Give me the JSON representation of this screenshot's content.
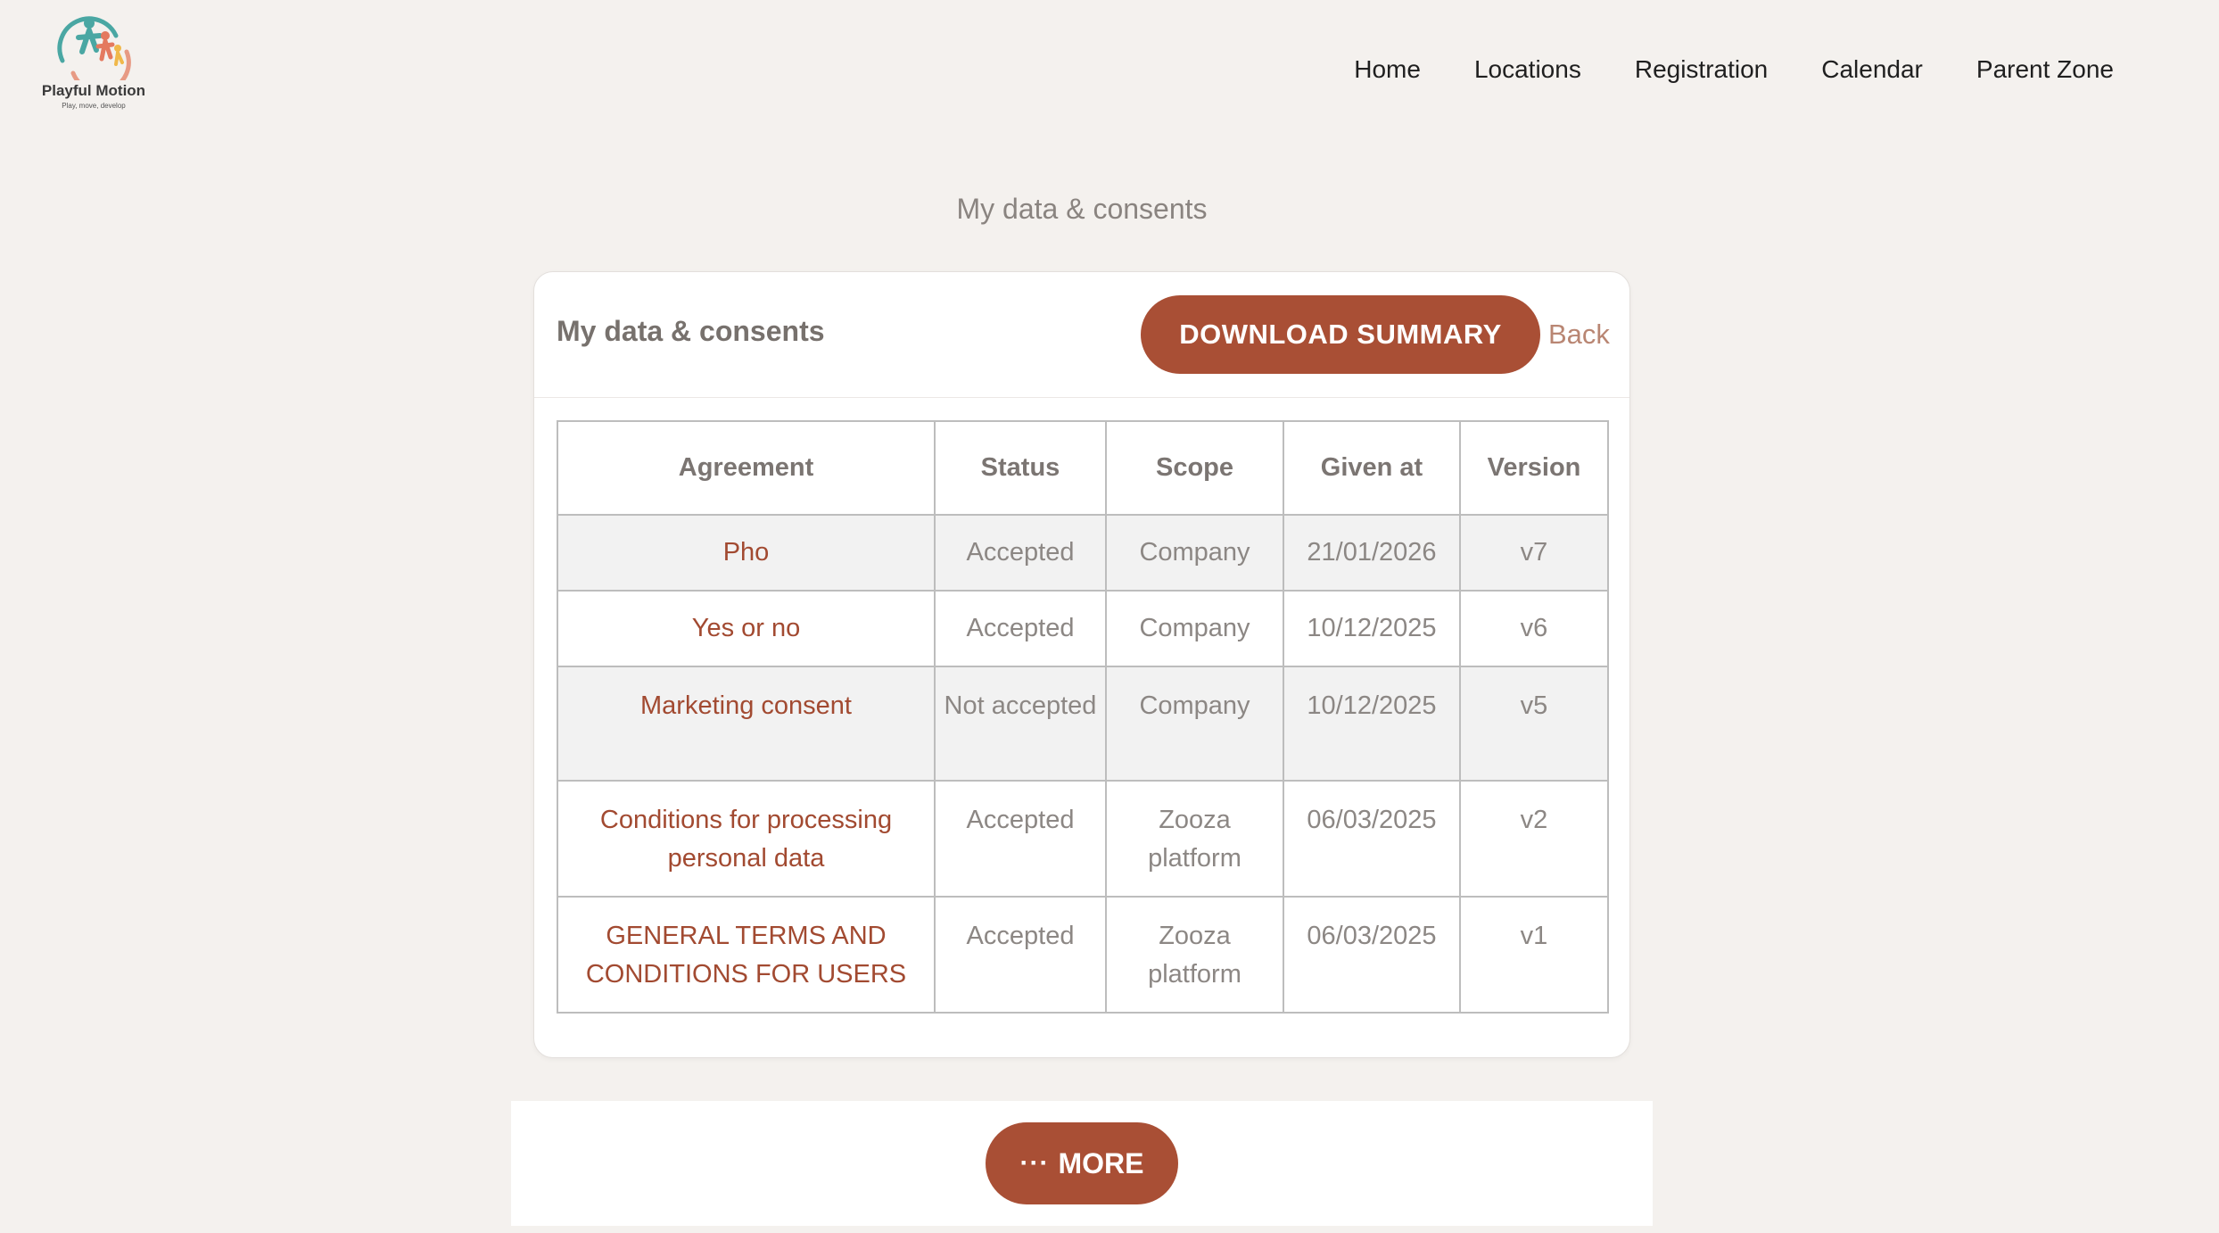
{
  "brand": {
    "name": "Playful Motion",
    "tagline": "Play, move, develop"
  },
  "nav": {
    "items": [
      {
        "label": "Home"
      },
      {
        "label": "Locations"
      },
      {
        "label": "Registration"
      },
      {
        "label": "Calendar"
      },
      {
        "label": "Parent Zone"
      }
    ]
  },
  "page": {
    "title": "My data & consents"
  },
  "card": {
    "title": "My data & consents",
    "download_label": "DOWNLOAD SUMMARY",
    "back_label": "Back"
  },
  "table": {
    "headers": [
      "Agreement",
      "Status",
      "Scope",
      "Given at",
      "Version"
    ],
    "rows": [
      {
        "agreement": "Pho",
        "status": "Accepted",
        "scope": "Company",
        "given_at": "21/01/2026",
        "version": "v7"
      },
      {
        "agreement": "Yes or no",
        "status": "Accepted",
        "scope": "Company",
        "given_at": "10/12/2025",
        "version": "v6"
      },
      {
        "agreement": "Marketing consent",
        "status": "Not accepted",
        "scope": "Company",
        "given_at": "10/12/2025",
        "version": "v5"
      },
      {
        "agreement": "Conditions for processing personal data",
        "status": "Accepted",
        "scope": "Zooza platform",
        "given_at": "06/03/2025",
        "version": "v2"
      },
      {
        "agreement": "GENERAL TERMS AND CONDITIONS FOR USERS",
        "status": "Accepted",
        "scope": "Zooza platform",
        "given_at": "06/03/2025",
        "version": "v1"
      }
    ]
  },
  "more": {
    "icon_text": "···",
    "label": "MORE"
  },
  "colors": {
    "accent": "#a94f35",
    "background": "#f4f1ee",
    "link": "#a24a31"
  }
}
